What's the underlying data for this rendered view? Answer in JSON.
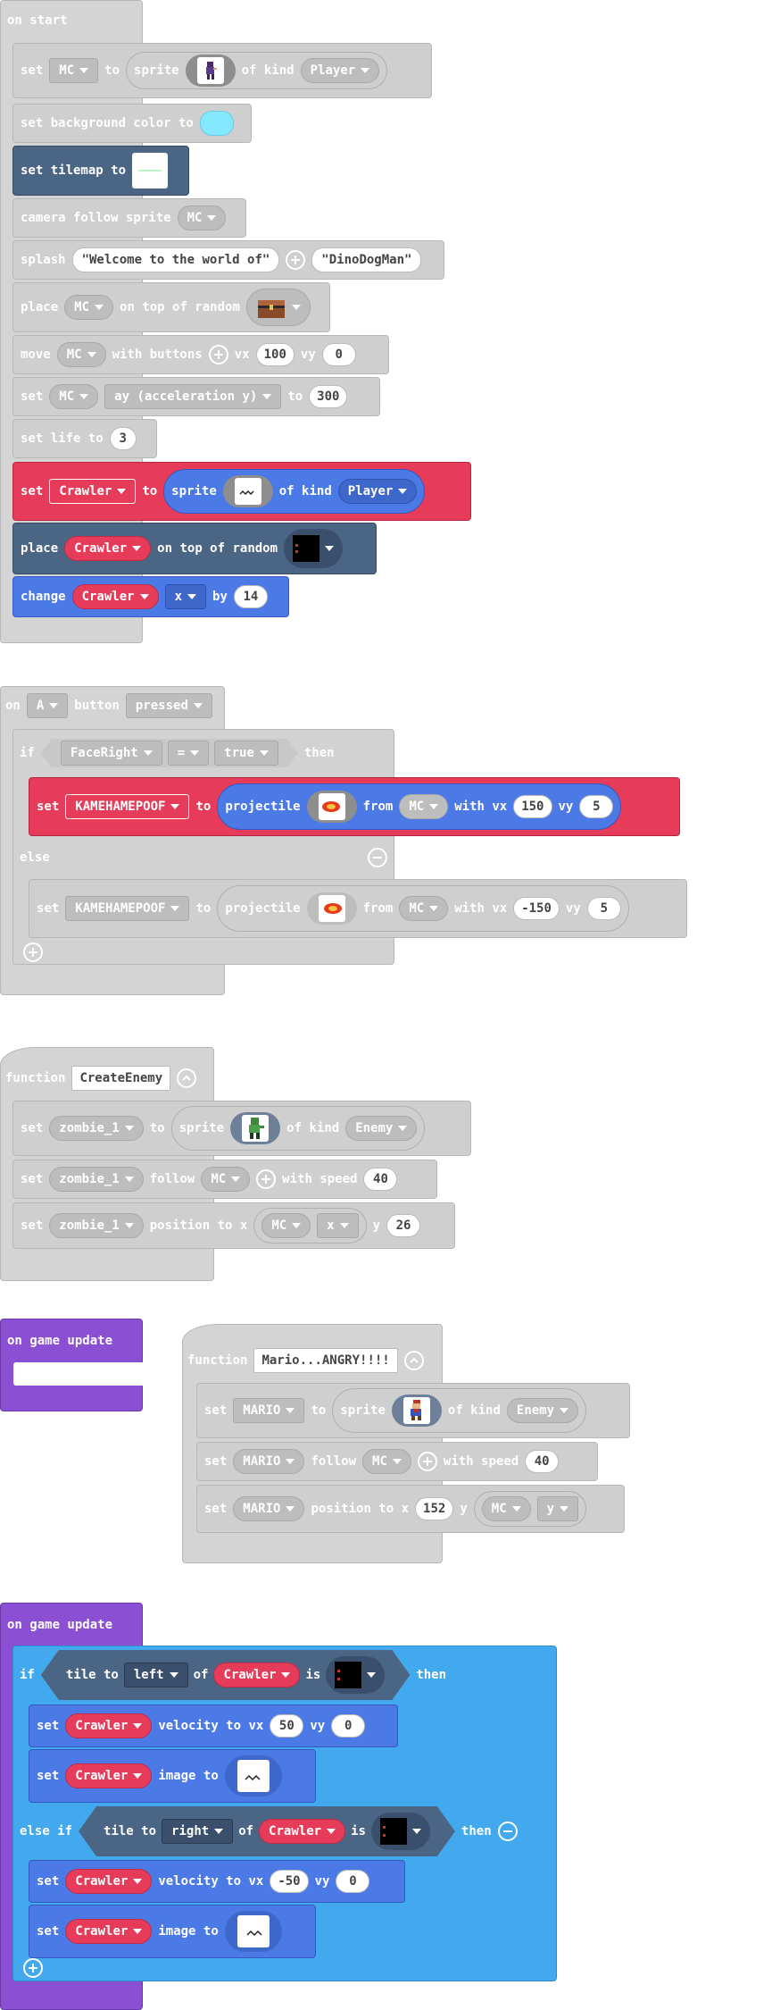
{
  "colors": {
    "loops_gray": "#cfcfcf",
    "sprites_red": "#e63c5a",
    "scene_navy": "#4b6584",
    "sprite_blue": "#4b79e6",
    "logic_sky": "#43a9ee",
    "game_purple": "#8a4fd3"
  },
  "on_start": {
    "hat": "on start",
    "set_mc": {
      "set": "set",
      "var": "MC",
      "to": "to",
      "sprite": "sprite",
      "of_kind": "of kind",
      "kind": "Player"
    },
    "bg": {
      "label": "set background color to"
    },
    "tilemap": {
      "label": "set tilemap to"
    },
    "camera": {
      "label": "camera follow sprite",
      "var": "MC"
    },
    "splash": {
      "label": "splash",
      "s1": "\"Welcome to the world of\"",
      "s2": "\"DinoDogMan\""
    },
    "place_mc": {
      "place": "place",
      "var": "MC",
      "rest": "on top of random"
    },
    "move": {
      "move": "move",
      "var": "MC",
      "with": "with buttons",
      "vx": "vx",
      "vxv": "100",
      "vy": "vy",
      "vyv": "0"
    },
    "set_ay": {
      "set": "set",
      "var": "MC",
      "prop": "ay (acceleration y)",
      "to": "to",
      "val": "300"
    },
    "life": {
      "label": "set life to",
      "val": "3"
    },
    "set_crawler": {
      "set": "set",
      "var": "Crawler",
      "to": "to",
      "sprite": "sprite",
      "of_kind": "of kind",
      "kind": "Player"
    },
    "place_crawler": {
      "place": "place",
      "var": "Crawler",
      "rest": "on top of random"
    },
    "change": {
      "change": "change",
      "var": "Crawler",
      "prop": "x",
      "by": "by",
      "val": "14"
    }
  },
  "on_a": {
    "on": "on",
    "btn": "A",
    "button": "button",
    "event": "pressed",
    "if": "if",
    "cond_var": "FaceRight",
    "op": "=",
    "cond_val": "true",
    "then": "then",
    "set1": {
      "set": "set",
      "var": "KAMEHAMEPOOF",
      "to": "to",
      "proj": "projectile",
      "from": "from",
      "src": "MC",
      "with": "with vx",
      "vx": "150",
      "vy": "vy",
      "vyv": "5"
    },
    "else": "else",
    "set2": {
      "set": "set",
      "var": "KAMEHAMEPOOF",
      "to": "to",
      "proj": "projectile",
      "from": "from",
      "src": "MC",
      "with": "with vx",
      "vx": "-150",
      "vy": "vy",
      "vyv": "5"
    }
  },
  "fn_enemy": {
    "function": "function",
    "name": "CreateEnemy",
    "s1": {
      "set": "set",
      "var": "zombie_1",
      "to": "to",
      "sprite": "sprite",
      "of_kind": "of kind",
      "kind": "Enemy"
    },
    "s2": {
      "set": "set",
      "var": "zombie_1",
      "follow": "follow",
      "target": "MC",
      "speed": "with speed",
      "val": "40"
    },
    "s3": {
      "set": "set",
      "var": "zombie_1",
      "pos": "position to x",
      "src": "MC",
      "prop": "x",
      "y": "y",
      "val": "26"
    }
  },
  "game_update_empty": {
    "label": "on game update"
  },
  "fn_mario": {
    "function": "function",
    "name": "Mario...ANGRY!!!!",
    "s1": {
      "set": "set",
      "var": "MARIO",
      "to": "to",
      "sprite": "sprite",
      "of_kind": "of kind",
      "kind": "Enemy"
    },
    "s2": {
      "set": "set",
      "var": "MARIO",
      "follow": "follow",
      "target": "MC",
      "speed": "with speed",
      "val": "40"
    },
    "s3": {
      "set": "set",
      "var": "MARIO",
      "pos": "position to x",
      "xval": "152",
      "y": "y",
      "src": "MC",
      "prop": "y"
    }
  },
  "game_update": {
    "label": "on game update",
    "if": "if",
    "tile": "tile to",
    "dir1": "left",
    "of": "of",
    "spr": "Crawler",
    "is": "is",
    "then": "then",
    "v1": {
      "set": "set",
      "var": "Crawler",
      "vel": "velocity to vx",
      "vx": "50",
      "vy": "vy",
      "vyv": "0"
    },
    "i1": {
      "set": "set",
      "var": "Crawler",
      "img": "image to"
    },
    "elseif": "else if",
    "dir2": "right",
    "v2": {
      "set": "set",
      "var": "Crawler",
      "vel": "velocity to vx",
      "vx": "-50",
      "vy": "vy",
      "vyv": "0"
    },
    "i2": {
      "set": "set",
      "var": "Crawler",
      "img": "image to"
    }
  }
}
